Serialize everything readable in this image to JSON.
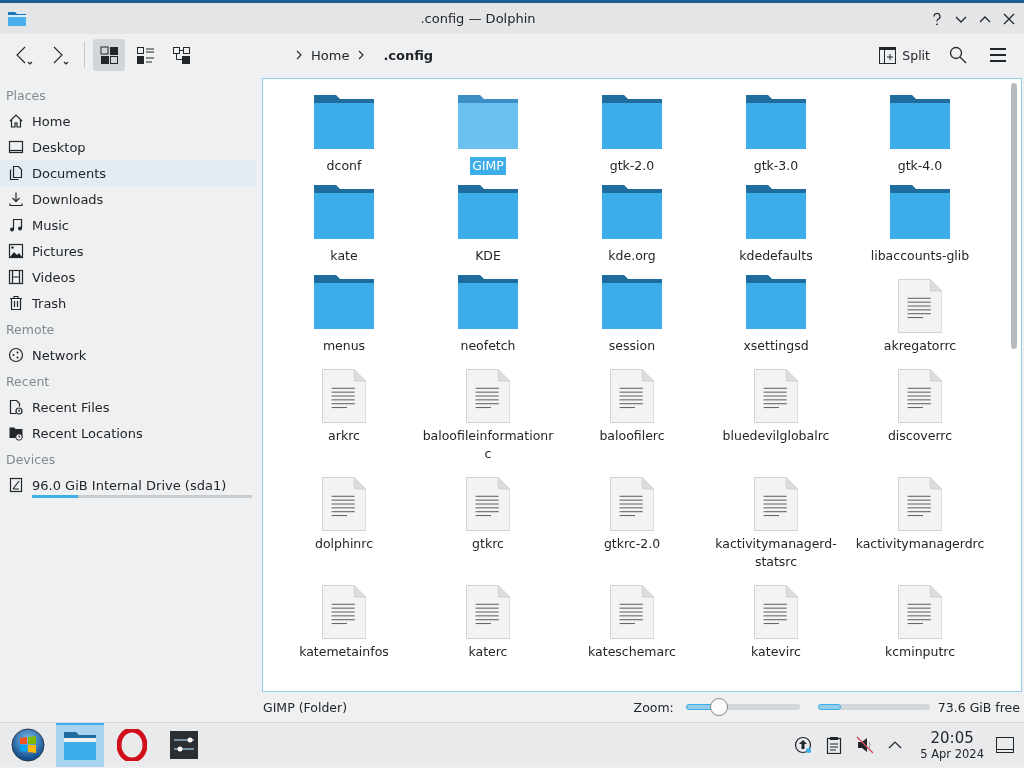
{
  "window": {
    "title": ".config — Dolphin"
  },
  "toolbar": {
    "view_modes": [
      {
        "kind": "icons",
        "selected": true
      },
      {
        "kind": "details",
        "selected": false
      },
      {
        "kind": "tree",
        "selected": false
      }
    ],
    "breadcrumb": [
      {
        "label": "Home",
        "current": false
      },
      {
        "label": ".config",
        "current": true
      }
    ],
    "split_label": "Split"
  },
  "sidebar": {
    "sections": [
      {
        "title": "Places",
        "items": [
          {
            "label": "Home",
            "hovered": false
          },
          {
            "label": "Desktop",
            "hovered": false
          },
          {
            "label": "Documents",
            "hovered": true
          },
          {
            "label": "Downloads",
            "hovered": false
          },
          {
            "label": "Music",
            "hovered": false
          },
          {
            "label": "Pictures",
            "hovered": false
          },
          {
            "label": "Videos",
            "hovered": false
          },
          {
            "label": "Trash",
            "hovered": false
          }
        ]
      },
      {
        "title": "Remote",
        "items": [
          {
            "label": "Network",
            "hovered": false
          }
        ]
      },
      {
        "title": "Recent",
        "items": [
          {
            "label": "Recent Files",
            "hovered": false
          },
          {
            "label": "Recent Locations",
            "hovered": false
          }
        ]
      },
      {
        "title": "Devices",
        "items": [
          {
            "label": "96.0 GiB Internal Drive (sda1)",
            "hovered": false,
            "level": 0.21
          }
        ]
      }
    ]
  },
  "files": [
    {
      "name": "dconf",
      "kind": "folder",
      "selected": false
    },
    {
      "name": "GIMP",
      "kind": "folder",
      "selected": true
    },
    {
      "name": "gtk-2.0",
      "kind": "folder",
      "selected": false
    },
    {
      "name": "gtk-3.0",
      "kind": "folder",
      "selected": false
    },
    {
      "name": "gtk-4.0",
      "kind": "folder",
      "selected": false
    },
    {
      "name": "kate",
      "kind": "folder",
      "selected": false
    },
    {
      "name": "KDE",
      "kind": "folder",
      "selected": false
    },
    {
      "name": "kde.org",
      "kind": "folder",
      "selected": false
    },
    {
      "name": "kdedefaults",
      "kind": "folder",
      "selected": false
    },
    {
      "name": "libaccounts-glib",
      "kind": "folder",
      "selected": false
    },
    {
      "name": "menus",
      "kind": "folder",
      "selected": false
    },
    {
      "name": "neofetch",
      "kind": "folder",
      "selected": false
    },
    {
      "name": "session",
      "kind": "folder",
      "selected": false
    },
    {
      "name": "xsettingsd",
      "kind": "folder",
      "selected": false
    },
    {
      "name": "akregatorrc",
      "kind": "file",
      "selected": false
    },
    {
      "name": "arkrc",
      "kind": "file",
      "selected": false
    },
    {
      "name": "baloofileinformationrc",
      "kind": "file",
      "selected": false
    },
    {
      "name": "baloofilerc",
      "kind": "file",
      "selected": false
    },
    {
      "name": "bluedevilglobalrc",
      "kind": "file",
      "selected": false
    },
    {
      "name": "discoverrc",
      "kind": "file",
      "selected": false
    },
    {
      "name": "dolphinrc",
      "kind": "file",
      "selected": false
    },
    {
      "name": "gtkrc",
      "kind": "file",
      "selected": false
    },
    {
      "name": "gtkrc-2.0",
      "kind": "file",
      "selected": false
    },
    {
      "name": "kactivitymanagerd-statsrc",
      "kind": "file",
      "selected": false
    },
    {
      "name": "kactivitymanagerdrc",
      "kind": "file",
      "selected": false
    },
    {
      "name": "katemetainfos",
      "kind": "file",
      "selected": false
    },
    {
      "name": "katerc",
      "kind": "file",
      "selected": false
    },
    {
      "name": "kateschemarc",
      "kind": "file",
      "selected": false
    },
    {
      "name": "katevirc",
      "kind": "file",
      "selected": false
    },
    {
      "name": "kcminputrc",
      "kind": "file",
      "selected": false
    }
  ],
  "status_bar": {
    "text": "GIMP (Folder)",
    "zoom_label": "Zoom:",
    "zoom": {
      "level": 0.29
    },
    "disk": {
      "level": 0.21
    },
    "free_text": "73.6 GiB free"
  },
  "taskbar": {
    "apps": [
      {
        "kind": "start",
        "active": false
      },
      {
        "kind": "files",
        "active": true
      },
      {
        "kind": "browser",
        "active": false
      },
      {
        "kind": "settings",
        "active": false
      }
    ],
    "clock": {
      "time": "20:05",
      "date": "5 Apr 2024"
    }
  }
}
